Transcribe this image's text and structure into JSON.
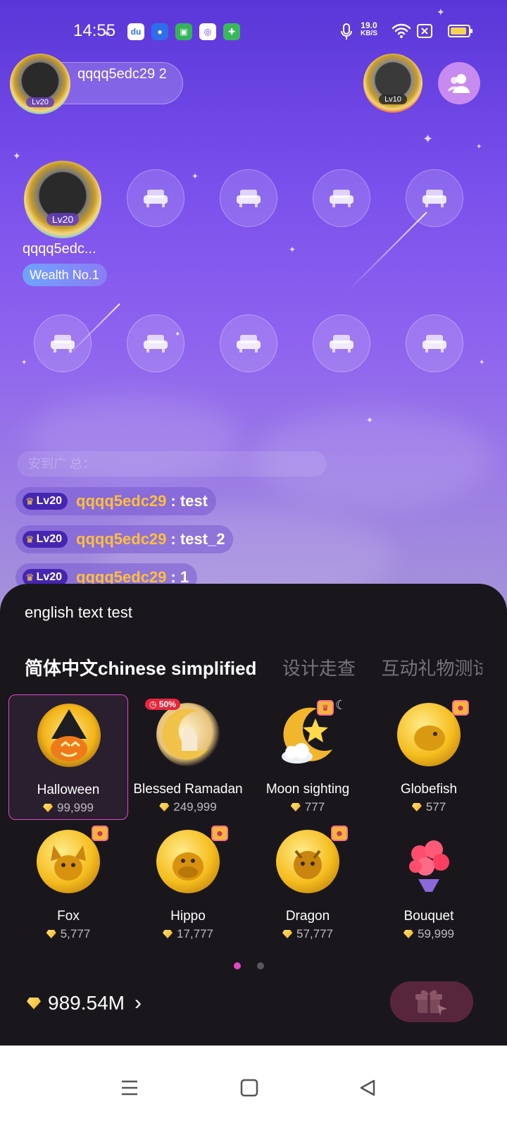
{
  "status_bar": {
    "time": "14:55",
    "net_speed": "19.0",
    "net_unit": "KB/S",
    "icons": [
      "baidu-app-icon",
      "blue-circle-app-icon",
      "green-app-icon",
      "purple-app-icon",
      "green-shield-app-icon",
      "mic-icon",
      "wifi-icon",
      "no-sim-icon",
      "battery-icon"
    ]
  },
  "host": {
    "name": "qqqq5edc29 2",
    "level": "Lv20",
    "right_avatar_level": "Lv10"
  },
  "seat_user": {
    "level": "Lv20",
    "name": "qqqq5edc...",
    "badge": "Wealth No.1"
  },
  "chat": {
    "faded_text": "安到广 总：",
    "messages": [
      {
        "level": "Lv20",
        "user": "qqqq5edc29",
        "text": ": test"
      },
      {
        "level": "Lv20",
        "user": "qqqq5edc29",
        "text": ": test_2"
      },
      {
        "level": "Lv20",
        "user": "qqqq5edc29",
        "text": ": 1"
      }
    ]
  },
  "sheet": {
    "title": "english text test",
    "tabs": [
      "简体中文chinese simplified",
      "设计走查",
      "互动礼物测试"
    ],
    "gifts": [
      {
        "name": "Halloween",
        "price": "99,999"
      },
      {
        "name": "Blessed Ramadan",
        "price": "249,999",
        "sale": "50%"
      },
      {
        "name": "Moon sighting",
        "price": "777"
      },
      {
        "name": "Globefish",
        "price": "577"
      },
      {
        "name": "Fox",
        "price": "5,777"
      },
      {
        "name": "Hippo",
        "price": "17,777"
      },
      {
        "name": "Dragon",
        "price": "57,777"
      },
      {
        "name": "Bouquet",
        "price": "59,999"
      }
    ],
    "balance": "989.54M",
    "colors": {
      "accent": "#e048c8",
      "sheet_bg": "#1a171c",
      "gold": "#ffbf3c"
    }
  }
}
